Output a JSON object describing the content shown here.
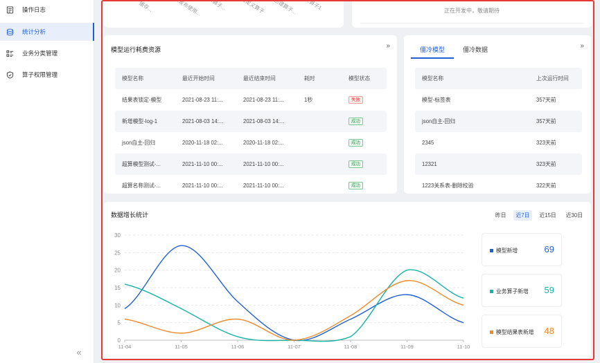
{
  "sidebar": {
    "items": [
      {
        "label": "操作日志",
        "icon": "log-icon",
        "active": false
      },
      {
        "label": "统计分析",
        "icon": "database-icon",
        "active": true
      },
      {
        "label": "业务分类管理",
        "icon": "list-icon",
        "active": false
      },
      {
        "label": "算子权限管理",
        "icon": "shield-icon",
        "active": false
      }
    ],
    "collapse_label": "«"
  },
  "top_left": {
    "tilted_labels": [
      "缓存...",
      "...发布使用...",
      "...算子...",
      "自定义算子",
      "...创建算子...",
      "...算子1"
    ]
  },
  "top_right": {
    "message": "正在开发中，敬请期待"
  },
  "model_card": {
    "title": "模型运行耗费资源",
    "expand_label": "»",
    "columns": [
      "模型名称",
      "最近开始时间",
      "最近结束时间",
      "耗时",
      "模型状态"
    ],
    "rows": [
      [
        "结果表锁定-模型",
        "2021-08-23 11:...",
        "2021-08-23 11:...",
        "1秒",
        "失败"
      ],
      [
        "新增模型-log-1",
        "2021-08-03 14:...",
        "2021-08-03 14:...",
        "",
        "成功"
      ],
      [
        "json自主-回归",
        "2020-11-18 02:...",
        "2020-11-18 02:...",
        "",
        "成功"
      ],
      [
        "超算模型测试-...",
        "2021-11-10 00:...",
        "2021-11-10 00:...",
        "",
        "成功"
      ],
      [
        "超算名称测试-...",
        "2021-11-10 00:...",
        "2021-11-10 00:...",
        "",
        "成功"
      ]
    ]
  },
  "cold_card": {
    "tabs": [
      "僵冷模型",
      "僵冷数据"
    ],
    "expand_label": "»",
    "columns": [
      "模型名称",
      "上次运行时间"
    ],
    "rows": [
      [
        "模型-标签表",
        "357天前"
      ],
      [
        "json自主-回归",
        "357天前"
      ],
      [
        "2345",
        "323天前"
      ],
      [
        "12321",
        "323天前"
      ],
      [
        "1223关系表-删除校验",
        "322天前"
      ]
    ]
  },
  "stat_card": {
    "title": "数据增长统计",
    "range_options": [
      "昨日",
      "近7日",
      "近15日",
      "近30日"
    ],
    "active_range": "近7日",
    "legend": [
      {
        "label": "模型新增",
        "value": "69",
        "color": "#1f5fd6"
      },
      {
        "label": "业务算子新增",
        "value": "59",
        "color": "#17b3a8"
      },
      {
        "label": "模型结果表新增",
        "value": "48",
        "color": "#f0892b"
      }
    ]
  },
  "chart_data": {
    "type": "line",
    "x": [
      "11-04",
      "11-05",
      "11-06",
      "11-07",
      "11-08",
      "11-09",
      "11-10"
    ],
    "ylim": [
      0,
      30
    ],
    "yticks": [
      0,
      5,
      10,
      15,
      20,
      25,
      30
    ],
    "grid": true,
    "series": [
      {
        "name": "模型新增",
        "color": "#1f5fd6",
        "values": [
          9,
          27,
          11,
          0,
          6,
          13,
          5
        ]
      },
      {
        "name": "业务算子新增",
        "color": "#17b3a8",
        "values": [
          16,
          9,
          1,
          0,
          1,
          20,
          12
        ]
      },
      {
        "name": "模型结果表新增",
        "color": "#f0892b",
        "values": [
          6,
          2,
          6,
          0,
          7,
          17,
          10
        ]
      }
    ]
  }
}
